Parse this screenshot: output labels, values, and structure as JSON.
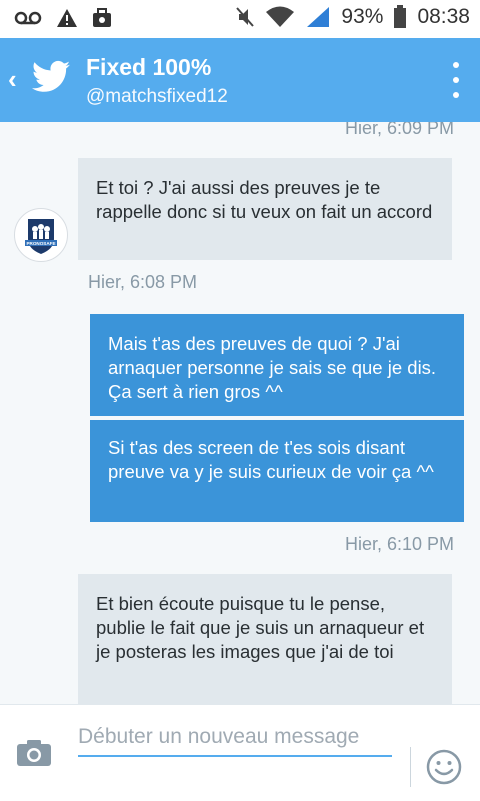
{
  "status_bar": {
    "battery_percent": "93%",
    "time": "08:38",
    "icons": [
      "voicemail-icon",
      "warning-icon",
      "briefcase-icon",
      "mute-icon",
      "wifi-icon",
      "signal-icon",
      "battery-icon"
    ]
  },
  "header": {
    "title": "Fixed 100%",
    "handle": "@matchsfixed12",
    "colors": {
      "bar": "#55acee"
    }
  },
  "messages": {
    "ts_top": "Hier, 6:09 PM",
    "msg1": "Et toi ? J'ai aussi des preuves je te rappelle donc si tu veux on fait un accord",
    "ts_msg1": "Hier, 6:08 PM",
    "msg2": "Mais t'as des preuves de quoi ? J'ai arnaquer personne je sais se que je dis. Ça sert à rien gros ^^",
    "msg3": "Si t'as des screen de t'es sois disant preuve va y je suis curieux de voir ça ^^",
    "ts_msg3": "Hier, 6:10 PM",
    "msg4": "Et bien écoute puisque tu le pense, publie le fait que je suis un arnaqueur et je posteras les images que j'ai de toi",
    "avatar_label": "PRONOSAFE"
  },
  "composer": {
    "placeholder": "Débuter un nouveau message"
  }
}
